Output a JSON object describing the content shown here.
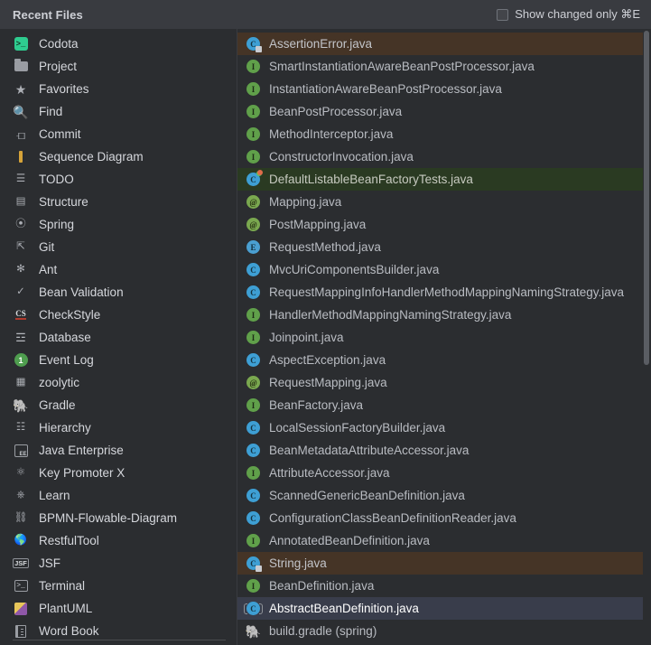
{
  "window": {
    "title": "Recent Files"
  },
  "header": {
    "checkbox_label": "Show changed only ⌘E",
    "checkbox_checked": false
  },
  "colors": {
    "background": "#2b2d30",
    "titlebar": "#393b40",
    "selected_row": "#393d4b",
    "modified_row": "#453426",
    "test_row": "#2a3a22",
    "divider": "#393b40",
    "text": "#b9bcc2",
    "text_bright": "#ffffff",
    "class_icon": "#3e9fd4",
    "interface_icon": "#60a04a",
    "annotation_icon": "#7aa84f"
  },
  "sidebar": {
    "items": [
      {
        "label": "Codota",
        "icon": "codota-icon"
      },
      {
        "label": "Project",
        "icon": "folder-icon"
      },
      {
        "label": "Favorites",
        "icon": "star-icon"
      },
      {
        "label": "Find",
        "icon": "search-icon"
      },
      {
        "label": "Commit",
        "icon": "commit-icon"
      },
      {
        "label": "Sequence Diagram",
        "icon": "sequence-diagram-icon"
      },
      {
        "label": "TODO",
        "icon": "todo-list-icon"
      },
      {
        "label": "Structure",
        "icon": "structure-icon"
      },
      {
        "label": "Spring",
        "icon": "spring-leaf-icon"
      },
      {
        "label": "Git",
        "icon": "git-branch-icon"
      },
      {
        "label": "Ant",
        "icon": "ant-icon"
      },
      {
        "label": "Bean Validation",
        "icon": "bean-validation-icon"
      },
      {
        "label": "CheckStyle",
        "icon": "checkstyle-icon"
      },
      {
        "label": "Database",
        "icon": "database-icon"
      },
      {
        "label": "Event Log",
        "icon": "event-log-badge-icon",
        "badge": "1"
      },
      {
        "label": "zoolytic",
        "icon": "zoolytic-icon"
      },
      {
        "label": "Gradle",
        "icon": "gradle-elephant-icon"
      },
      {
        "label": "Hierarchy",
        "icon": "hierarchy-icon"
      },
      {
        "label": "Java Enterprise",
        "icon": "java-enterprise-icon"
      },
      {
        "label": "Key Promoter X",
        "icon": "key-promoter-icon"
      },
      {
        "label": "Learn",
        "icon": "learn-graduation-icon"
      },
      {
        "label": "BPMN-Flowable-Diagram",
        "icon": "bpmn-diagram-icon"
      },
      {
        "label": "RestfulTool",
        "icon": "globe-icon"
      },
      {
        "label": "JSF",
        "icon": "jsf-icon"
      },
      {
        "label": "Terminal",
        "icon": "terminal-icon"
      },
      {
        "label": "PlantUML",
        "icon": "plantuml-icon"
      },
      {
        "label": "Word Book",
        "icon": "word-book-icon"
      }
    ]
  },
  "files": {
    "items": [
      {
        "label": "build.gradle (spring)",
        "icon": "gradle-file-icon",
        "state": "normal"
      },
      {
        "label": "AbstractBeanDefinition.java",
        "icon": "abstract-class-icon",
        "state": "selected"
      },
      {
        "label": "BeanDefinition.java",
        "icon": "interface-icon",
        "state": "normal"
      },
      {
        "label": "String.java",
        "icon": "class-locked-icon",
        "state": "modified"
      },
      {
        "label": "AnnotatedBeanDefinition.java",
        "icon": "interface-icon",
        "state": "normal"
      },
      {
        "label": "ConfigurationClassBeanDefinitionReader.java",
        "icon": "class-icon",
        "state": "normal"
      },
      {
        "label": "ScannedGenericBeanDefinition.java",
        "icon": "class-icon",
        "state": "normal"
      },
      {
        "label": "AttributeAccessor.java",
        "icon": "interface-icon",
        "state": "normal"
      },
      {
        "label": "BeanMetadataAttributeAccessor.java",
        "icon": "class-icon",
        "state": "normal"
      },
      {
        "label": "LocalSessionFactoryBuilder.java",
        "icon": "class-icon",
        "state": "normal"
      },
      {
        "label": "BeanFactory.java",
        "icon": "interface-icon",
        "state": "normal"
      },
      {
        "label": "RequestMapping.java",
        "icon": "annotation-icon",
        "state": "normal"
      },
      {
        "label": "AspectException.java",
        "icon": "class-icon",
        "state": "normal"
      },
      {
        "label": "Joinpoint.java",
        "icon": "interface-icon",
        "state": "normal"
      },
      {
        "label": "HandlerMethodMappingNamingStrategy.java",
        "icon": "interface-icon",
        "state": "normal"
      },
      {
        "label": "RequestMappingInfoHandlerMethodMappingNamingStrategy.java",
        "icon": "class-icon",
        "state": "normal"
      },
      {
        "label": "MvcUriComponentsBuilder.java",
        "icon": "class-icon",
        "state": "normal"
      },
      {
        "label": "RequestMethod.java",
        "icon": "enum-icon",
        "state": "normal"
      },
      {
        "label": "PostMapping.java",
        "icon": "annotation-icon",
        "state": "normal"
      },
      {
        "label": "Mapping.java",
        "icon": "annotation-icon",
        "state": "normal"
      },
      {
        "label": "DefaultListableBeanFactoryTests.java",
        "icon": "test-class-icon",
        "state": "test"
      },
      {
        "label": "ConstructorInvocation.java",
        "icon": "interface-icon",
        "state": "normal"
      },
      {
        "label": "MethodInterceptor.java",
        "icon": "interface-icon",
        "state": "normal"
      },
      {
        "label": "BeanPostProcessor.java",
        "icon": "interface-icon",
        "state": "normal"
      },
      {
        "label": "InstantiationAwareBeanPostProcessor.java",
        "icon": "interface-icon",
        "state": "normal"
      },
      {
        "label": "SmartInstantiationAwareBeanPostProcessor.java",
        "icon": "interface-icon",
        "state": "normal"
      },
      {
        "label": "AssertionError.java",
        "icon": "class-locked-icon",
        "state": "modified"
      }
    ]
  }
}
